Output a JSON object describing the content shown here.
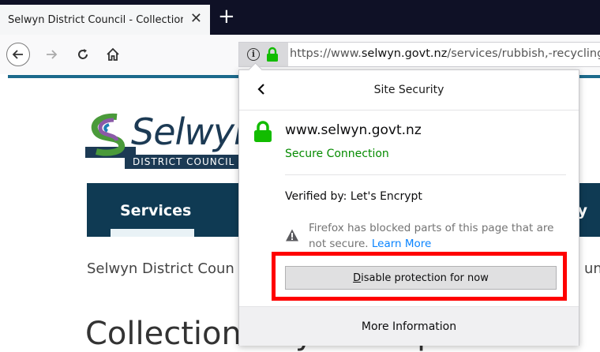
{
  "browser": {
    "tab_title": "Selwyn District Council - Collection",
    "tab_close": "✕",
    "new_tab": "+",
    "url_scheme": "https://www.",
    "url_domain": "selwyn.govt.nz",
    "url_path": "/services/rubbish,-recycling"
  },
  "page": {
    "logo_text": "Selwyn",
    "logo_sub": "DISTRICT COUNCIL",
    "nav_services": "Services",
    "nav_right": "y",
    "breadcrumb": "Selwyn District Coun",
    "breadcrumb_right": "unic",
    "heading": "Collection Day Lookup"
  },
  "panel": {
    "title": "Site Security",
    "host": "www.selwyn.govt.nz",
    "status": "Secure Connection",
    "verified": "Verified by: Let's Encrypt",
    "blocked_text": "Firefox has blocked parts of this page that are not secure.",
    "learn_more": "Learn More",
    "disable_button_accel": "D",
    "disable_button_rest": "isable protection for now",
    "more_info": "More Information"
  },
  "colors": {
    "secure_green": "#058b00",
    "annotation_red": "#ff0000",
    "tabbar": "#0f1126",
    "council_blue": "#0f3a53"
  }
}
